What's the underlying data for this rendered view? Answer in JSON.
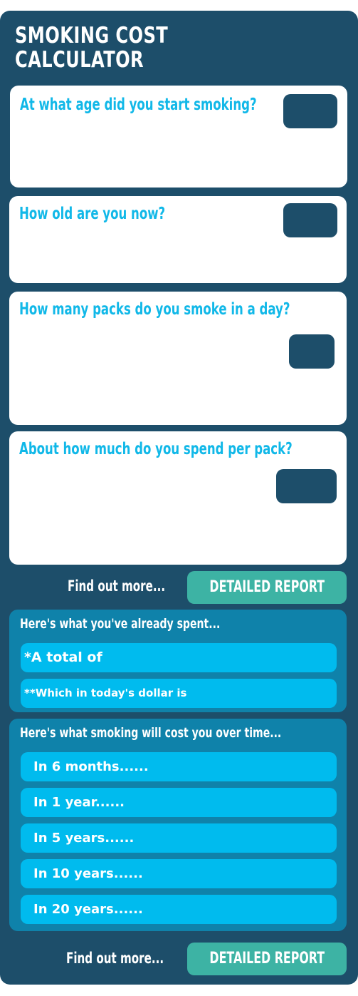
{
  "app": {
    "title": "SMOKING COST\nCALCULATOR"
  },
  "questions": [
    {
      "label": "At what age did you start smoking?",
      "value": ""
    },
    {
      "label": "How old are you now?",
      "value": ""
    },
    {
      "label": "How many packs do you smoke in a day?",
      "value": ""
    },
    {
      "label": "About how much do you spend per pack?",
      "value": ""
    }
  ],
  "report_links": [
    {
      "prompt": "Find out more...",
      "button": "DETAILED REPORT"
    },
    {
      "prompt": "Find out more...",
      "button": "DETAILED REPORT"
    }
  ],
  "spent": {
    "title": "Here's what you've already spent...",
    "rows": [
      "*A total of",
      "**Which in today's dollar is"
    ]
  },
  "future": {
    "title": "Here's what smoking will cost you over time...",
    "rows": [
      "In 6 months......",
      "In 1 year......",
      "In 5 years......",
      "In 10 years......",
      "In 20 years......"
    ]
  },
  "colors": {
    "panel": "#1d4e6a",
    "accent": "#11b8e8",
    "button": "#3db3a4",
    "section": "#0f82aa",
    "pill": "#00bbee"
  }
}
